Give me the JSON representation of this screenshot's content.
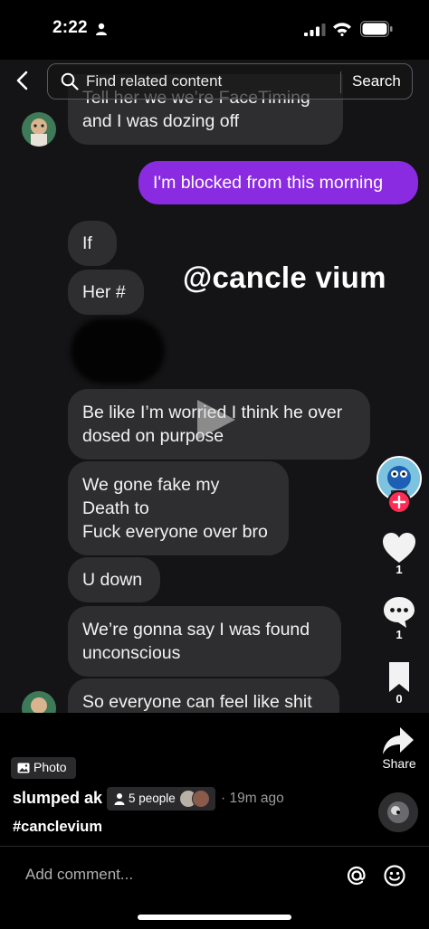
{
  "status_bar": {
    "time": "2:22",
    "icons": [
      "person-icon",
      "signal-icon",
      "wifi-icon",
      "battery-icon"
    ]
  },
  "search": {
    "placeholder": "Find related content",
    "button_label": "Search",
    "icons": [
      "back-icon",
      "search-icon"
    ]
  },
  "chat_messages": [
    {
      "side": "received",
      "text": "Tell her we we’re FaceTiming\nand I was dozing off"
    },
    {
      "side": "sent",
      "text": "I'm blocked from this morning"
    },
    {
      "side": "received",
      "text": "If"
    },
    {
      "side": "received",
      "text": "Her #"
    },
    {
      "side": "received",
      "text": "",
      "note_hidden": true
    },
    {
      "side": "received",
      "text": "Be like I’m worried I think he over\ndosed on purpose"
    },
    {
      "side": "received",
      "text": "We gone fake my\nDeath to\nFuck everyone over bro"
    },
    {
      "side": "received",
      "text": "U down"
    },
    {
      "side": "received",
      "text": "We’re gonna say I was found\nunconscious"
    },
    {
      "side": "received",
      "text": "So everyone can feel like shit"
    }
  ],
  "watermark_text": "@cancle vium",
  "side_rail": {
    "likes": "1",
    "comments": "1",
    "saves": "0",
    "share_label": "Share",
    "icons": [
      "follow-plus-icon",
      "heart-icon",
      "comment-icon",
      "bookmark-icon",
      "share-icon"
    ]
  },
  "post": {
    "media_type": "Photo",
    "username": "slumped ak",
    "people_tag": "5 people",
    "time_ago": "· 19m ago",
    "hashtag": "#canclevium"
  },
  "comment_bar": {
    "placeholder": "Add comment...",
    "icons": [
      "at-icon",
      "emoji-icon"
    ]
  },
  "colors": {
    "sent_bubble": "#8a2be2",
    "received_bubble": "#2e2e30",
    "follow_badge": "#fe2c55",
    "background": "#000000"
  }
}
